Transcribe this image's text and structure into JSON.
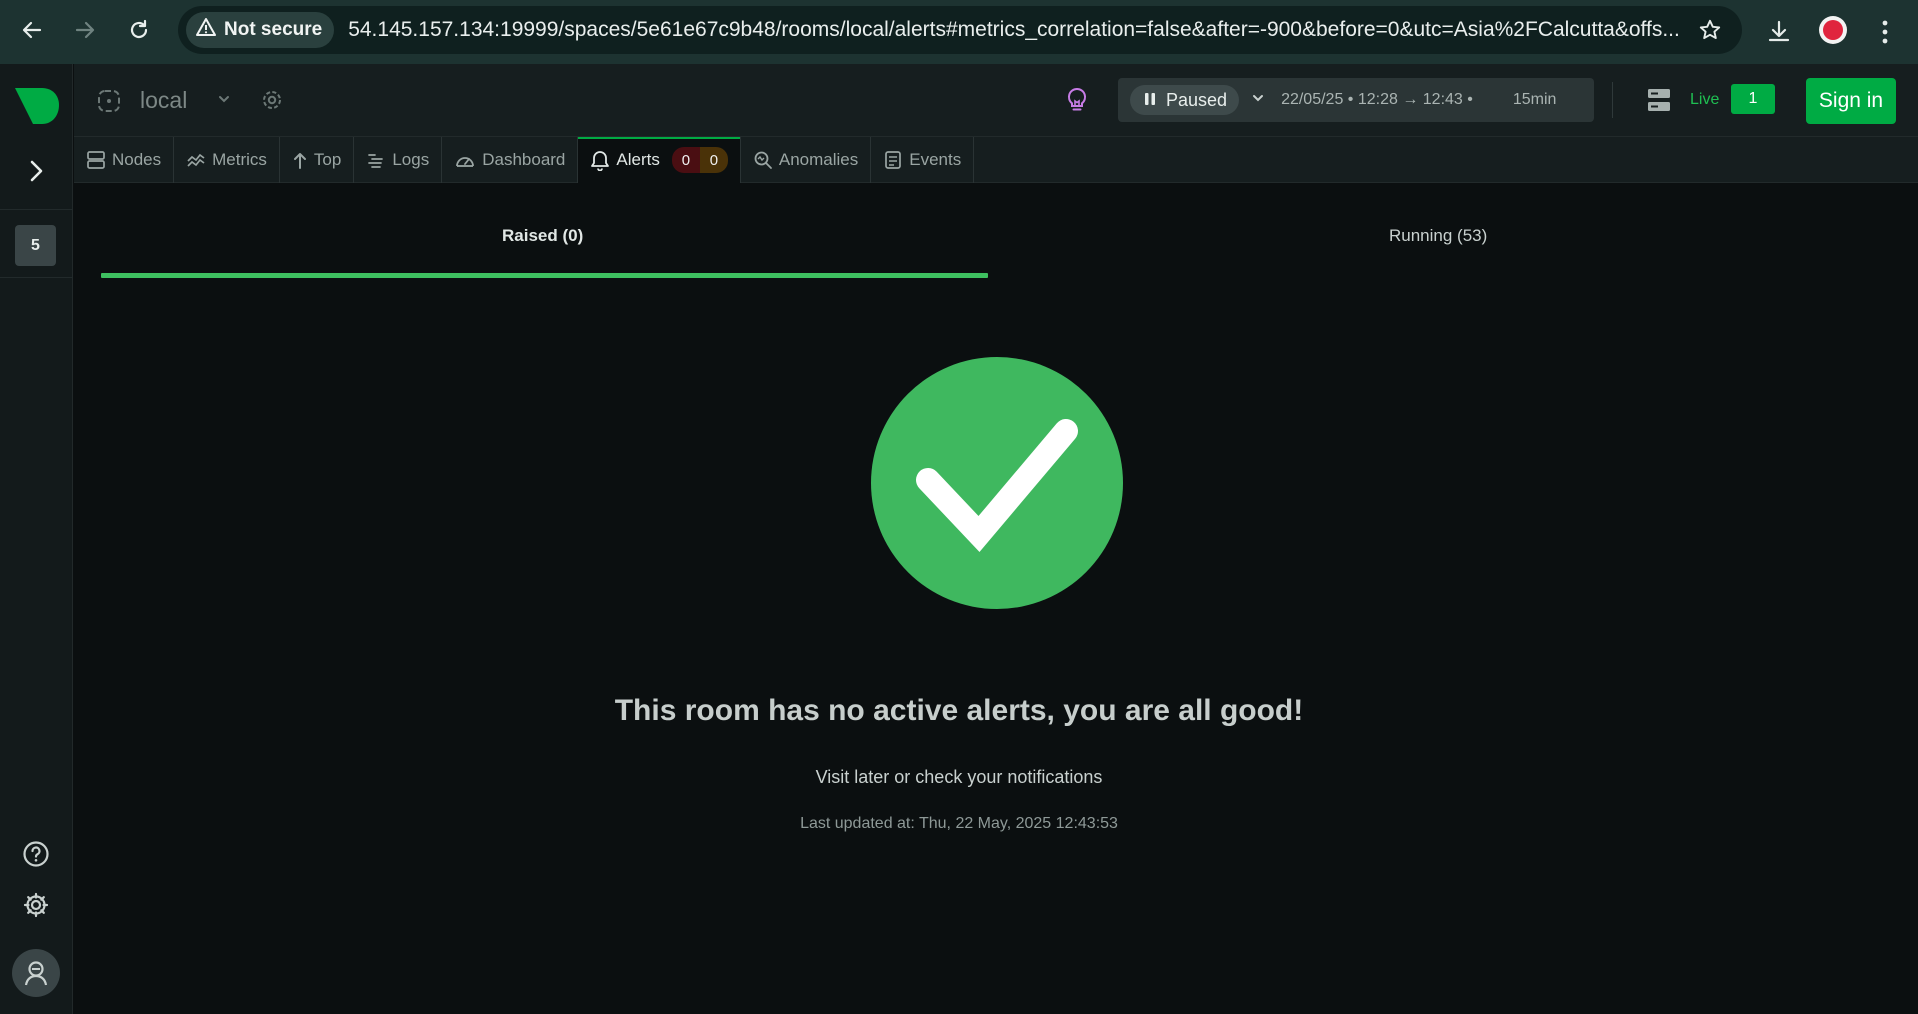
{
  "browser": {
    "security_label": "Not secure",
    "url": "54.145.157.134:19999/spaces/5e61e67c9b48/rooms/local/alerts#metrics_correlation=false&after=-900&before=0&utc=Asia%2FCalcutta&offs..."
  },
  "rail": {
    "badge": "5"
  },
  "header": {
    "room_name": "local",
    "time": {
      "status": "Paused",
      "range": "22/05/25 • 12:28 → 12:43 •",
      "duration": "15min"
    },
    "live_label": "Live",
    "live_count": "1",
    "signin_label": "Sign in"
  },
  "tabs": [
    {
      "label": "Nodes",
      "icon": "nodes-icon"
    },
    {
      "label": "Metrics",
      "icon": "metrics-icon"
    },
    {
      "label": "Top",
      "icon": "top-icon"
    },
    {
      "label": "Logs",
      "icon": "logs-icon"
    },
    {
      "label": "Dashboard",
      "icon": "dashboard-icon"
    },
    {
      "label": "Alerts",
      "icon": "bell-icon",
      "critical": "0",
      "warning": "0"
    },
    {
      "label": "Anomalies",
      "icon": "anomalies-icon"
    },
    {
      "label": "Events",
      "icon": "events-icon"
    }
  ],
  "subtabs": {
    "raised": "Raised (0)",
    "running": "Running (53)"
  },
  "empty_state": {
    "title": "This room has no active alerts, you are all good!",
    "subtitle": "Visit later or check your notifications",
    "updated": "Last updated at: Thu, 22 May, 2025 12:43:53"
  },
  "colors": {
    "accent": "#00ab44",
    "success": "#3fb85f"
  }
}
